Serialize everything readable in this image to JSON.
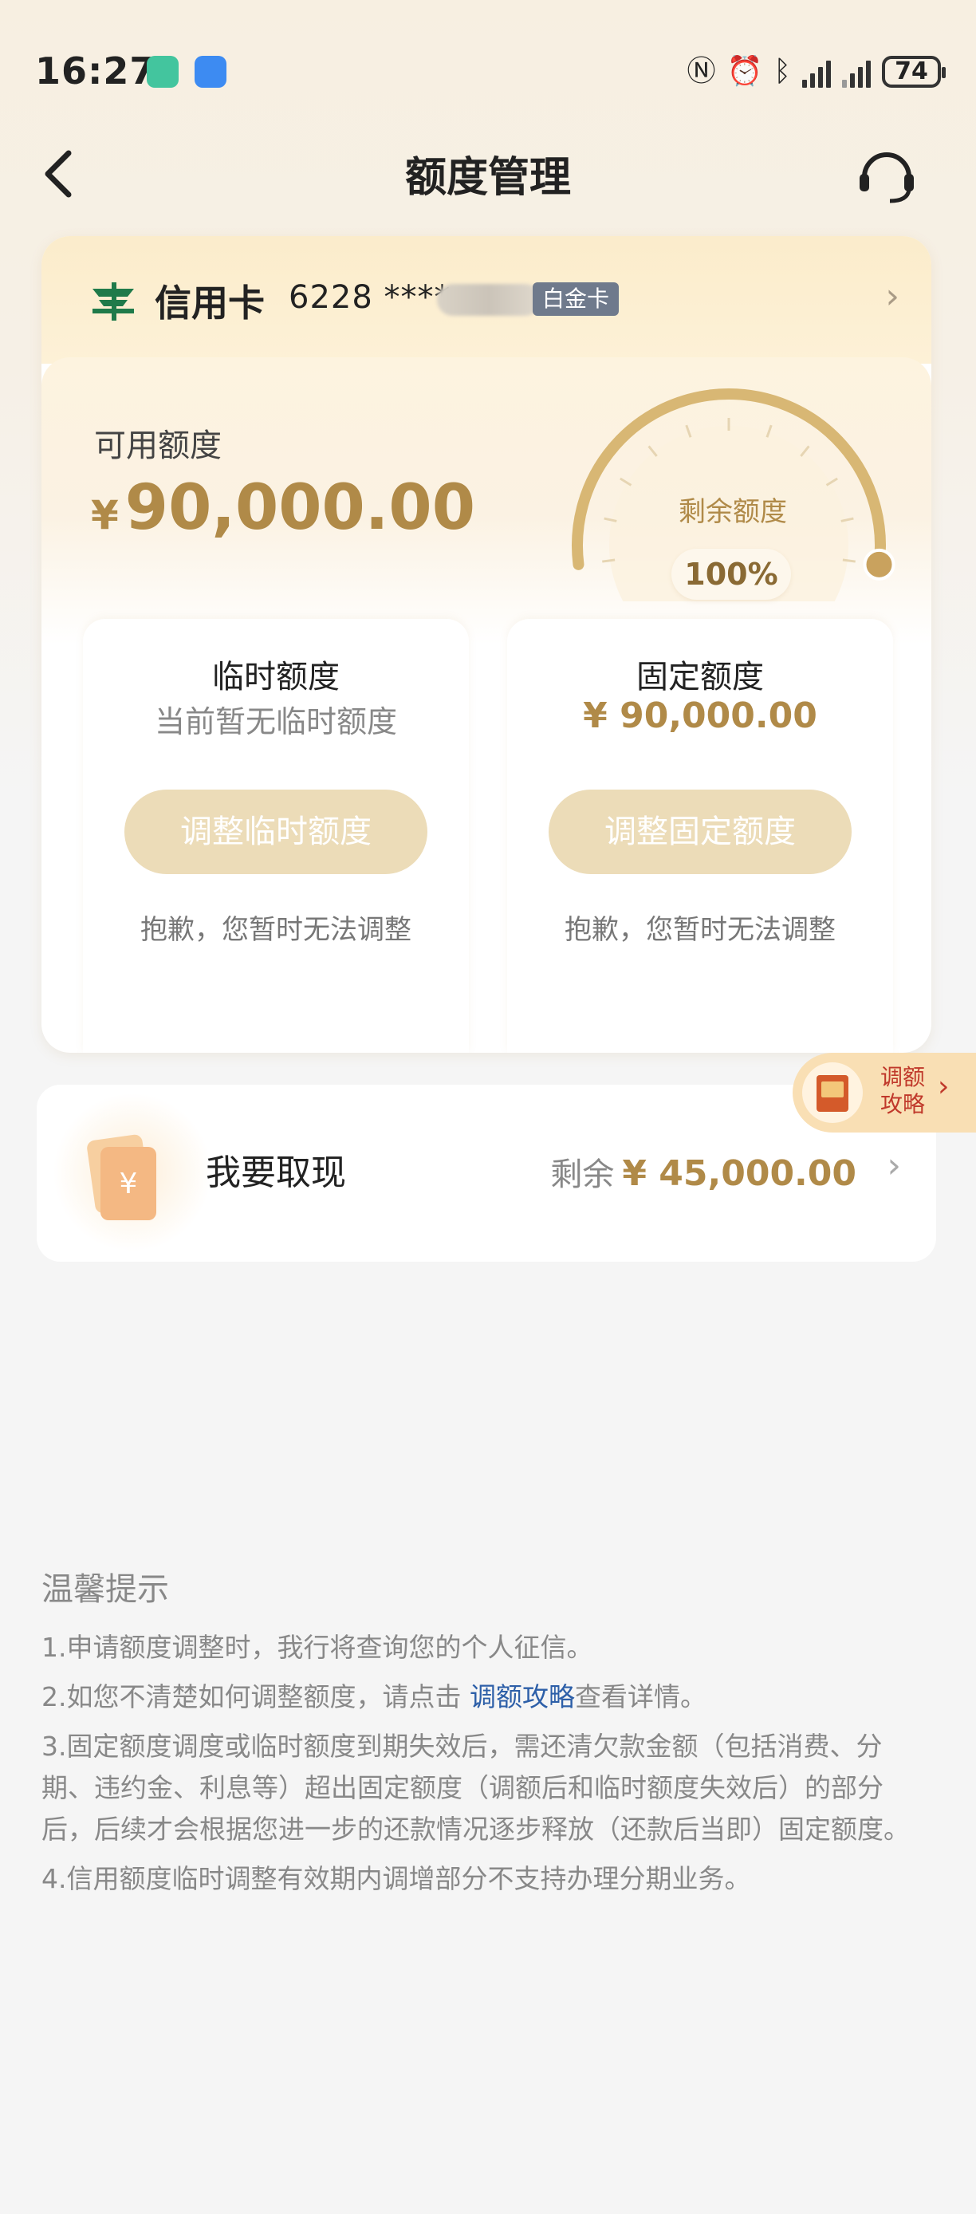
{
  "status_bar": {
    "time": "16:27",
    "battery": "74",
    "icons": [
      "nfc-icon",
      "alarm-icon",
      "bluetooth-icon",
      "signal-icon",
      "signal-icon"
    ]
  },
  "header": {
    "title": "额度管理",
    "back_icon": "chevron-left-icon",
    "service_icon": "headset-icon"
  },
  "card": {
    "type_label": "信用卡",
    "number_masked": "6228 ****",
    "tier_badge": "白金卡",
    "available_label": "可用额度",
    "currency": "¥",
    "available_amount": "90,000.00",
    "gauge_label": "剩余额度",
    "gauge_percent_text": "100%",
    "gauge_fraction": 1.0,
    "temporary": {
      "title": "临时额度",
      "desc": "当前暂无临时额度",
      "button": "调整临时额度",
      "note": "抱歉，您暂时无法调整"
    },
    "fixed": {
      "title": "固定额度",
      "value": "¥ 90,000.00",
      "button": "调整固定额度",
      "note": "抱歉，您暂时无法调整"
    }
  },
  "withdraw": {
    "label": "我要取现",
    "remain_label": "剩余",
    "remain_amount": "¥ 45,000.00"
  },
  "float_guide": {
    "line1": "调额",
    "line2": "攻略"
  },
  "tips": {
    "title": "温馨提示",
    "item1": "1.申请额度调整时，我行将查询您的个人征信。",
    "item2_prefix": "2.如您不清楚如何调整额度，请点击 ",
    "item2_link": "调额攻略",
    "item2_suffix": "查看详情。",
    "item3": "3.固定额度调度或临时额度到期失效后，需还清欠款金额（包括消费、分期、违约金、利息等）超出固定额度（调额后和临时额度失效后）的部分后，后续才会根据您进一步的还款情况逐步释放（还款后当即）固定额度。",
    "item4": "4.信用额度临时调整有效期内调增部分不支持办理分期业务。"
  },
  "colors": {
    "gold": "#b08a48",
    "link": "#2d5fa8",
    "button_disabled": "#ecdcb8"
  }
}
